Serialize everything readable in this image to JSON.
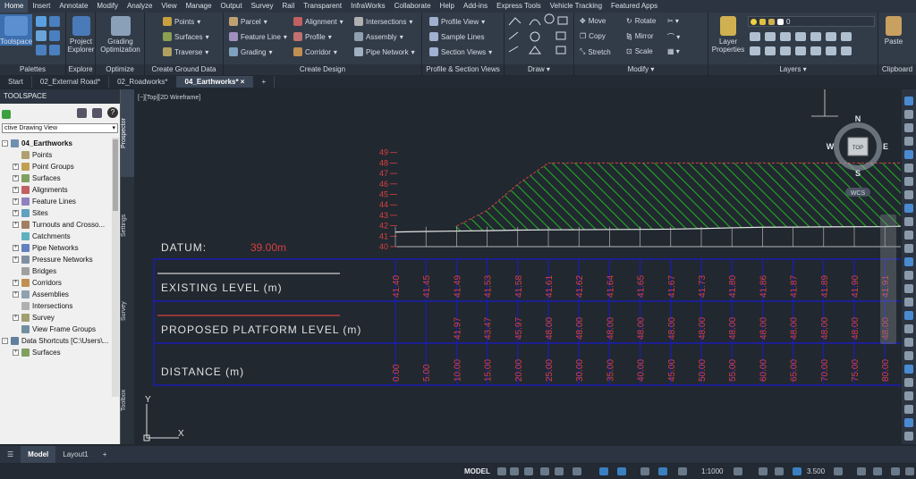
{
  "menu": [
    "Home",
    "Insert",
    "Annotate",
    "Modify",
    "Analyze",
    "View",
    "Manage",
    "Output",
    "Survey",
    "Rail",
    "Transparent",
    "InfraWorks",
    "Collaborate",
    "Help",
    "Add-ins",
    "Express Tools",
    "Vehicle Tracking",
    "Featured Apps"
  ],
  "ribbon": {
    "palettes": {
      "title": "Palettes",
      "toolspace": "Toolspace"
    },
    "explore": {
      "title": "Explore",
      "project_explorer": "Project Explorer"
    },
    "optimize": {
      "title": "Optimize",
      "grading_optimization": "Grading Optimization"
    },
    "ground": {
      "title": "Create Ground Data",
      "points": "Points",
      "surfaces": "Surfaces",
      "traverse": "Traverse"
    },
    "design": {
      "title": "Create Design",
      "parcel": "Parcel",
      "feature_line": "Feature Line",
      "grading": "Grading",
      "alignment": "Alignment",
      "profile": "Profile",
      "corridor": "Corridor",
      "intersections": "Intersections",
      "assembly": "Assembly",
      "pipe_network": "Pipe Network"
    },
    "profile_section": {
      "title": "Profile & Section Views",
      "profile_view": "Profile View",
      "sample_lines": "Sample Lines",
      "section_views": "Section Views"
    },
    "draw": {
      "title": "Draw"
    },
    "modify": {
      "title": "Modify",
      "move": "Move",
      "rotate": "Rotate",
      "copy": "Copy",
      "mirror": "Mirror",
      "stretch": "Stretch",
      "scale": "Scale"
    },
    "layers": {
      "title": "Layers",
      "layer_properties": "Layer Properties",
      "current_layer": "0"
    },
    "clipboard": {
      "title": "Clipboard",
      "paste": "Paste"
    }
  },
  "tabs": [
    "Start",
    "02_External Road*",
    "02_Roadworks*",
    "04_Earthworks*"
  ],
  "toolspace": {
    "title": "TOOLSPACE",
    "view": "ctive Drawing View",
    "tree": [
      {
        "label": "04_Earthworks",
        "level": 0,
        "expander": "-",
        "bold": true,
        "icon": "drawing-icon"
      },
      {
        "label": "Points",
        "level": 1,
        "expander": "",
        "icon": "points-icon"
      },
      {
        "label": "Point Groups",
        "level": 1,
        "expander": "+",
        "icon": "point-groups-icon"
      },
      {
        "label": "Surfaces",
        "level": 1,
        "expander": "+",
        "icon": "surfaces-icon"
      },
      {
        "label": "Alignments",
        "level": 1,
        "expander": "+",
        "icon": "alignments-icon"
      },
      {
        "label": "Feature Lines",
        "level": 1,
        "expander": "+",
        "icon": "feature-lines-icon"
      },
      {
        "label": "Sites",
        "level": 1,
        "expander": "+",
        "icon": "sites-icon"
      },
      {
        "label": "Turnouts and Crosso...",
        "level": 1,
        "expander": "+",
        "icon": "turnouts-icon"
      },
      {
        "label": "Catchments",
        "level": 1,
        "expander": "",
        "icon": "catchments-icon"
      },
      {
        "label": "Pipe Networks",
        "level": 1,
        "expander": "+",
        "icon": "pipe-networks-icon"
      },
      {
        "label": "Pressure Networks",
        "level": 1,
        "expander": "+",
        "icon": "pressure-networks-icon"
      },
      {
        "label": "Bridges",
        "level": 1,
        "expander": "",
        "icon": "bridges-icon"
      },
      {
        "label": "Corridors",
        "level": 1,
        "expander": "+",
        "icon": "corridors-icon"
      },
      {
        "label": "Assemblies",
        "level": 1,
        "expander": "+",
        "icon": "assemblies-icon"
      },
      {
        "label": "Intersections",
        "level": 1,
        "expander": "",
        "icon": "intersections-icon"
      },
      {
        "label": "Survey",
        "level": 1,
        "expander": "+",
        "icon": "survey-icon"
      },
      {
        "label": "View Frame Groups",
        "level": 1,
        "expander": "",
        "icon": "view-frame-icon"
      },
      {
        "label": "Data Shortcuts [C:\\Users\\...",
        "level": 0,
        "expander": "-",
        "bold": false,
        "icon": "data-shortcuts-icon"
      },
      {
        "label": "Surfaces",
        "level": 1,
        "expander": "+",
        "icon": "surfaces-icon"
      }
    ]
  },
  "vertical_tabs": [
    "Prospector",
    "Settings",
    "Survey",
    "Toolbox"
  ],
  "viewport": {
    "label": "[−][Top][2D Wireframe]"
  },
  "viewcube": {
    "n": "N",
    "s": "S",
    "e": "E",
    "w": "W",
    "top": "TOP",
    "wcs": "WCS"
  },
  "profile": {
    "elevations": [
      "49",
      "48",
      "47",
      "46",
      "45",
      "44",
      "43",
      "42",
      "41",
      "40"
    ],
    "datum_label": "DATUM:",
    "datum_value": "39.00m",
    "row_labels": [
      "EXISTING LEVEL (m)",
      "PROPOSED PLATFORM LEVEL (m)",
      "DISTANCE (m)"
    ],
    "existing": [
      "41.40",
      "41.45",
      "41.49",
      "41.53",
      "41.58",
      "41.61",
      "41.62",
      "41.64",
      "41.65",
      "41.67",
      "41.73",
      "41.80",
      "41.86",
      "41.87",
      "41.89",
      "41.90",
      "41.91"
    ],
    "proposed": [
      "",
      "",
      "41.97",
      "43.47",
      "45.97",
      "48.00",
      "48.00",
      "48.00",
      "48.00",
      "48.00",
      "48.00",
      "48.00",
      "48.00",
      "48.00",
      "48.00",
      "48.00",
      "48.00"
    ],
    "distance": [
      "0.00",
      "5.00",
      "10.00",
      "15.00",
      "20.00",
      "25.00",
      "30.00",
      "35.00",
      "40.00",
      "45.00",
      "50.00",
      "55.00",
      "60.00",
      "65.00",
      "70.00",
      "75.00",
      "80.00"
    ]
  },
  "ucs": {
    "x": "X",
    "y": "Y"
  },
  "layout_tabs": [
    "Model",
    "Layout1"
  ],
  "status": {
    "model": "MODEL",
    "scale": "1:1000",
    "value": "3.500"
  },
  "colors": {
    "grid": "#1a1acc",
    "hatch": "#22aa22",
    "red": "#d84040",
    "white": "#e6e6e6"
  }
}
